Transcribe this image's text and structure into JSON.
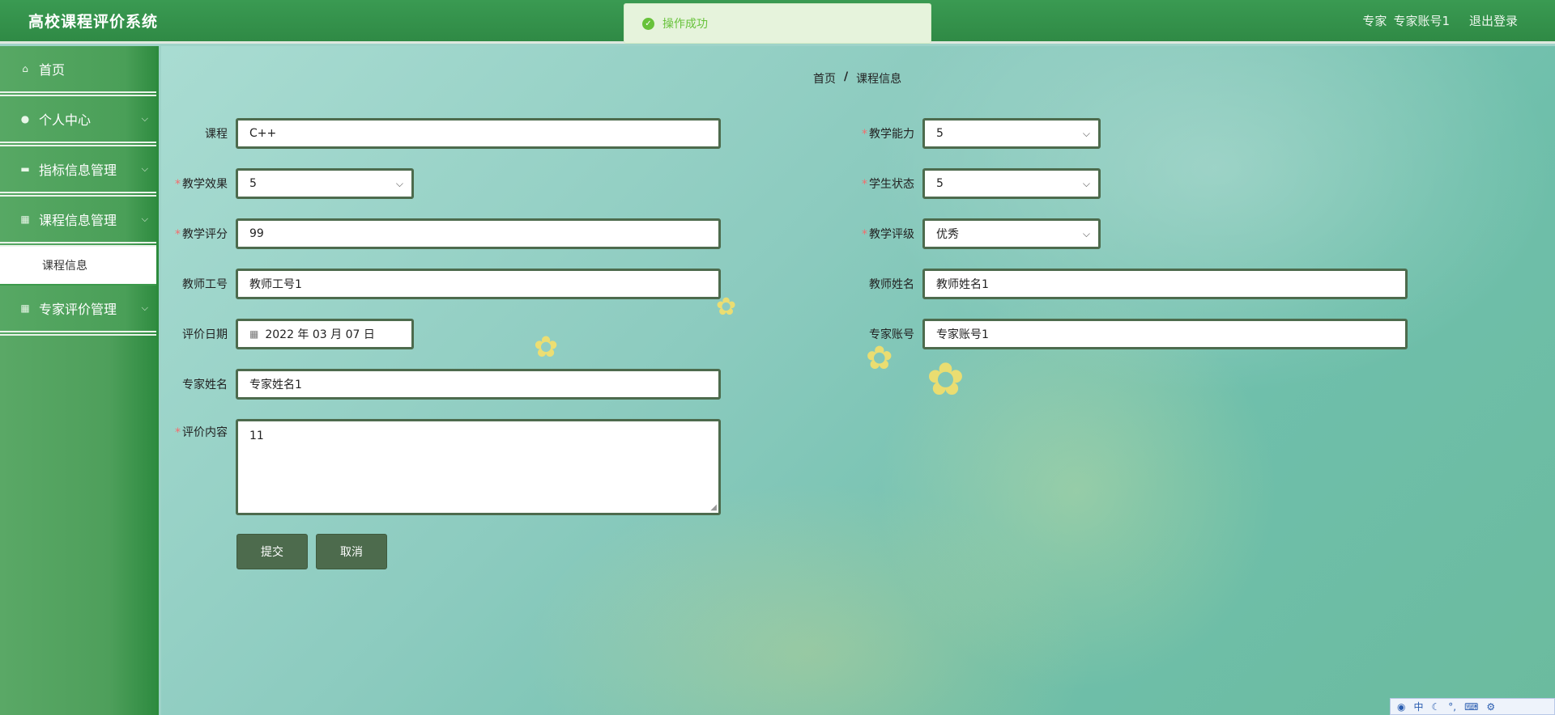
{
  "header": {
    "title": "高校课程评价系统",
    "role": "专家",
    "account": "专家账号1",
    "logout": "退出登录"
  },
  "toast": {
    "message": "操作成功"
  },
  "sidebar": {
    "items": [
      {
        "label": "首页",
        "icon": "home-icon"
      },
      {
        "label": "个人中心",
        "icon": "user-icon"
      },
      {
        "label": "指标信息管理",
        "icon": "chat-icon"
      },
      {
        "label": "课程信息管理",
        "icon": "grid-icon"
      },
      {
        "label": "专家评价管理",
        "icon": "grid-icon"
      }
    ],
    "sub_item": "课程信息"
  },
  "breadcrumb": {
    "home": "首页",
    "sep": "/",
    "current": "课程信息"
  },
  "form": {
    "course": {
      "label": "课程",
      "value": "C++"
    },
    "teaching_ability": {
      "label": "教学能力",
      "value": "5"
    },
    "teaching_effect": {
      "label": "教学效果",
      "value": "5"
    },
    "student_status": {
      "label": "学生状态",
      "value": "5"
    },
    "teaching_score": {
      "label": "教学评分",
      "value": "99"
    },
    "teaching_grade": {
      "label": "教学评级",
      "value": "优秀"
    },
    "teacher_id": {
      "label": "教师工号",
      "value": "教师工号1"
    },
    "teacher_name": {
      "label": "教师姓名",
      "value": "教师姓名1"
    },
    "eval_date": {
      "label": "评价日期",
      "value": "2022 年 03 月 07 日"
    },
    "expert_account": {
      "label": "专家账号",
      "value": "专家账号1"
    },
    "expert_name": {
      "label": "专家姓名",
      "value": "专家姓名1"
    },
    "eval_content": {
      "label": "评价内容",
      "value": "11"
    },
    "submit": "提交",
    "cancel": "取消"
  },
  "ime": {
    "mode": "中"
  }
}
